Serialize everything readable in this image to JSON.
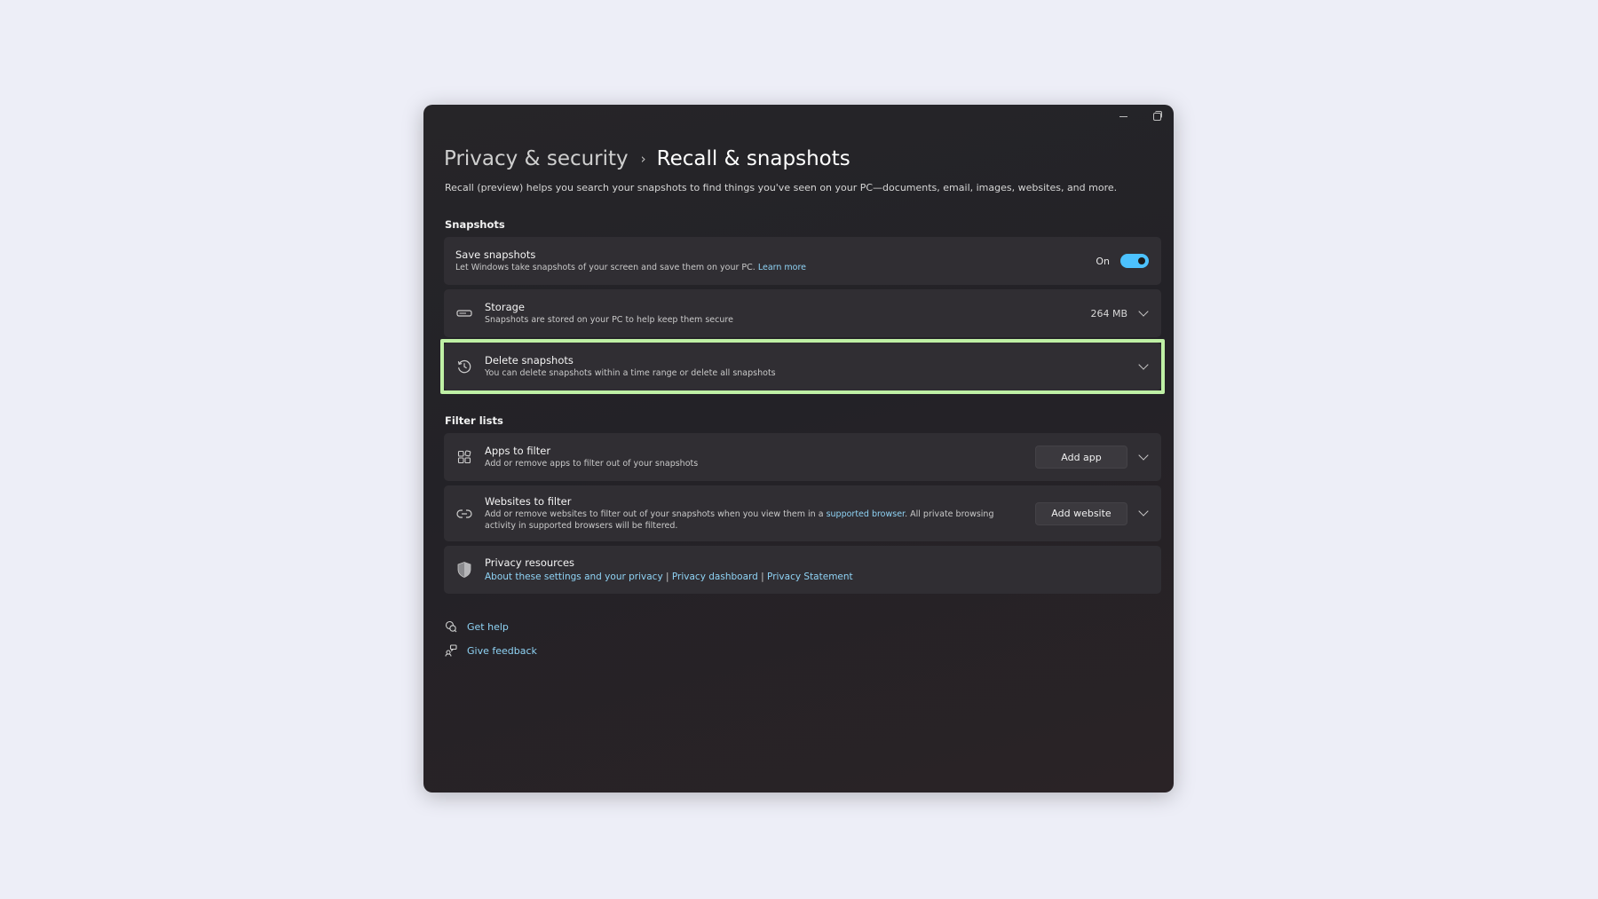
{
  "window": {
    "minimize_glyph": "minimize-icon",
    "maximize_glyph": "restore-icon"
  },
  "breadcrumb": {
    "parent": "Privacy & security",
    "separator": "›",
    "current": "Recall & snapshots"
  },
  "description": "Recall (preview) helps you search your snapshots to find things you've seen on your PC—documents, email, images, websites, and more.",
  "sections": {
    "snapshots": {
      "title": "Snapshots",
      "save": {
        "title": "Save snapshots",
        "subtitle": "Let Windows take snapshots of your screen and save them on your PC.",
        "link": "Learn more",
        "toggle_label": "On",
        "toggle_state": true
      },
      "storage": {
        "title": "Storage",
        "subtitle": "Snapshots are stored on your PC to help keep them secure",
        "value": "264 MB",
        "icon": "storage-drive-icon"
      },
      "delete": {
        "title": "Delete snapshots",
        "subtitle": "You can delete snapshots within a time range or delete all snapshots",
        "icon": "history-icon"
      }
    },
    "filters": {
      "title": "Filter lists",
      "apps": {
        "title": "Apps to filter",
        "subtitle": "Add or remove apps to filter out of your snapshots",
        "button": "Add app",
        "icon": "apps-grid-icon"
      },
      "websites": {
        "title": "Websites to filter",
        "subtitle_before": "Add or remove websites to filter out of your snapshots when you view them in a",
        "subtitle_link": "supported browser",
        "subtitle_after": ". All private browsing activity in supported browsers will be filtered.",
        "button": "Add website",
        "icon": "link-icon"
      },
      "privacy": {
        "title": "Privacy resources",
        "link1": "About these settings and your privacy",
        "sep": "|",
        "link2": "Privacy dashboard",
        "link3": "Privacy Statement",
        "icon": "shield-icon"
      }
    }
  },
  "footer": {
    "help": "Get help",
    "feedback": "Give feedback"
  },
  "colors": {
    "accent": "#4cc2ff",
    "link": "#8fd3f5",
    "highlight": "#bff0a5",
    "card": "#302e33",
    "background": "#edeef7"
  }
}
